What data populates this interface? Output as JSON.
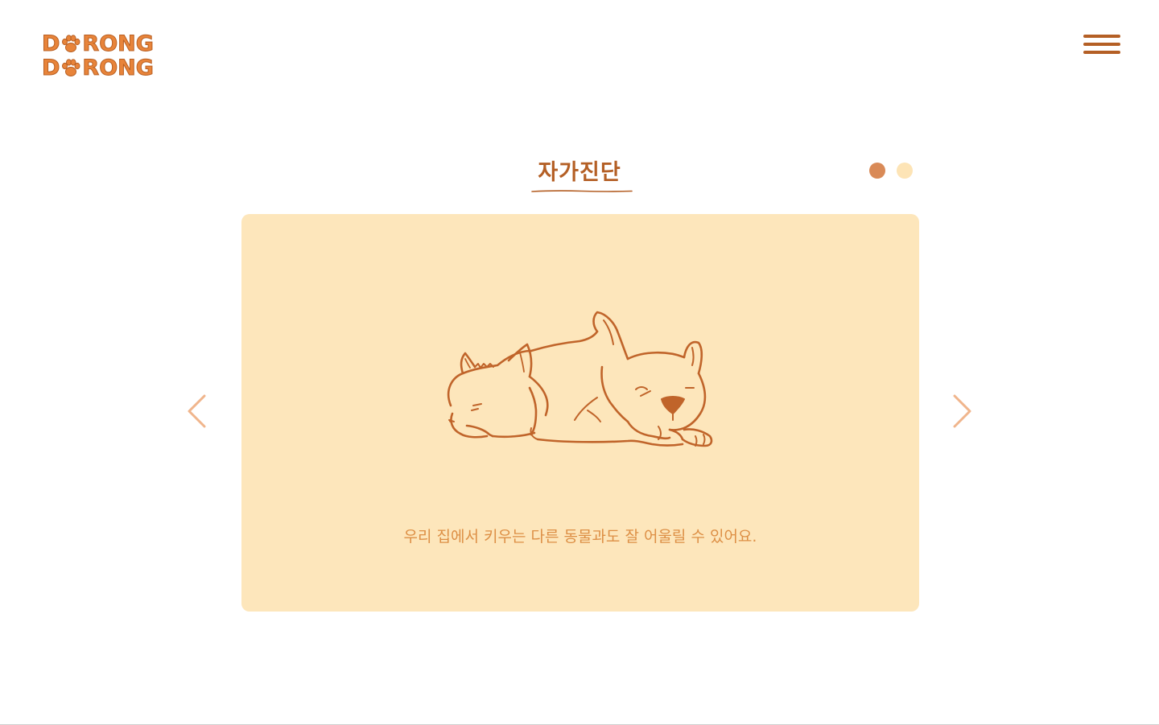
{
  "header": {
    "logo_line_1": [
      "D",
      "RONG"
    ],
    "logo_line_2": [
      "D",
      "RONG"
    ],
    "menu_icon": "hamburger-icon"
  },
  "section": {
    "title": "자가진단",
    "active_slide": 1,
    "slide_count": 2
  },
  "card": {
    "illustration": "sleeping-cat-and-dog-illustration",
    "caption": "우리 집에서 키우는 다른 동물과도 잘 어울릴 수 있어요."
  },
  "nav": {
    "prev_icon": "chevron-left-icon",
    "next_icon": "chevron-right-icon"
  },
  "colors": {
    "brand_brown": "#b45f25",
    "logo_orange": "#e8843a",
    "card_bg": "#fde6bb",
    "caption": "#dd8f45",
    "dot_active": "#d98a57",
    "dot_inactive": "#fde4b6",
    "arrow": "#f0b58c"
  }
}
